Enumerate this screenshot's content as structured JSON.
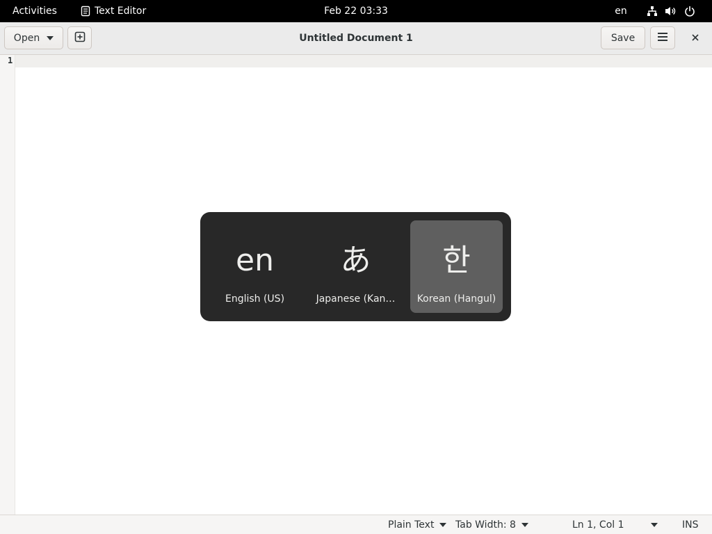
{
  "topbar": {
    "activities": "Activities",
    "app_name": "Text Editor",
    "clock": "Feb 22  03:33",
    "input_indicator": "en",
    "icons": [
      "network-icon",
      "volume-icon",
      "power-icon"
    ]
  },
  "headerbar": {
    "open_label": "Open",
    "title": "Untitled Document 1",
    "save_label": "Save",
    "icons": [
      "new-tab-icon",
      "hamburger-menu-icon",
      "close-icon"
    ]
  },
  "editor": {
    "line_numbers": [
      "1"
    ],
    "content": ""
  },
  "statusbar": {
    "language": "Plain Text",
    "tab_width": "Tab Width: 8",
    "position": "Ln 1, Col 1",
    "mode": "INS"
  },
  "input_switcher": {
    "sources": [
      {
        "glyph": "en",
        "name": "English (US)",
        "selected": false
      },
      {
        "glyph": "あ",
        "name": "Japanese (Kan…",
        "selected": false
      },
      {
        "glyph": "한",
        "name": "Korean (Hangul)",
        "selected": true
      }
    ]
  },
  "colors": {
    "topbar_bg": "#000000",
    "headerbar_bg": "#ebebeb",
    "switcher_bg": "#282828",
    "switcher_selected": "#5f5f5f"
  }
}
